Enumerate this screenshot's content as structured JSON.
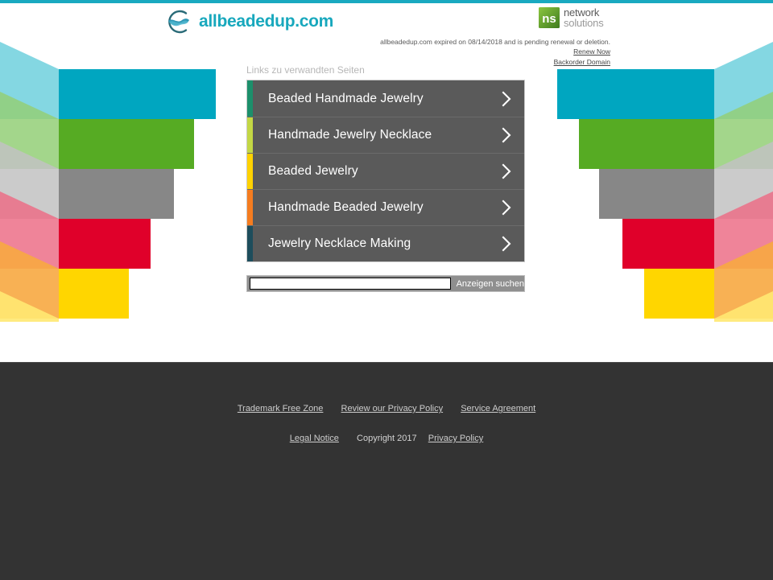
{
  "theme": {
    "top_strip_color": "#19a9c0",
    "brand_color": "#18a8bd",
    "panel_bg": "#5a5a5a",
    "footer_bg": "#333333"
  },
  "header": {
    "brand_name": "allbeadedup.com",
    "brand_logo_icon": "swirl-wave-circle-icon",
    "partner": {
      "mark_icon": "network-solutions-ns-mark-icon",
      "line1": "network",
      "line2": "solutions"
    },
    "expiry_notice": "allbeadedup.com expired on 08/14/2018 and is pending renewal or deletion.",
    "renew_link": "Renew Now",
    "backorder_link": "Backorder Domain"
  },
  "links_panel": {
    "heading": "Links zu verwandten Seiten",
    "chevron_icon": "chevron-right-icon",
    "items": [
      {
        "label": "Beaded Handmade Jewelry",
        "accent": "#1c8f6b"
      },
      {
        "label": "Handmade Jewelry Necklace",
        "accent": "#c3d744"
      },
      {
        "label": "Beaded Jewelry",
        "accent": "#ffd200"
      },
      {
        "label": "Handmade Beaded Jewelry",
        "accent": "#f57c1f"
      },
      {
        "label": "Jewelry Necklace Making",
        "accent": "#1d4d5c"
      }
    ]
  },
  "search": {
    "value": "",
    "placeholder": "",
    "button_label": "Anzeigen suchen"
  },
  "footer": {
    "links": [
      "Trademark Free Zone",
      "Review our Privacy Policy",
      "Service Agreement"
    ],
    "legal_notice": "Legal Notice",
    "copyright": "Copyright 2017",
    "privacy_policy": "Privacy Policy"
  },
  "artwork": {
    "bars": [
      {
        "color": "#00a6c0",
        "shadow": "#6fd0dd"
      },
      {
        "color": "#56ab23",
        "shadow": "#93cf77"
      },
      {
        "color": "#878787",
        "shadow": "#c2c2c2"
      },
      {
        "color": "#e0002a",
        "shadow": "#ec6f87"
      },
      {
        "color": "#ffd600",
        "shadow": "#ffe972"
      }
    ]
  }
}
